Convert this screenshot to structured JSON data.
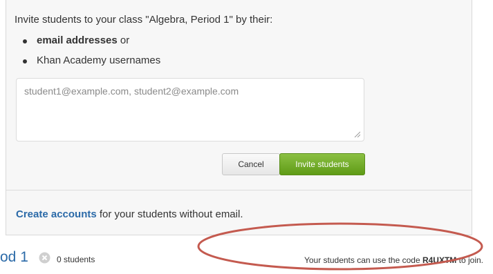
{
  "invite": {
    "prompt_prefix": "Invite students to your class \"",
    "class_name": "Algebra, Period 1",
    "prompt_suffix": "\" by their:",
    "options": [
      {
        "bold": "email addresses",
        "rest": " or"
      },
      {
        "bold": "",
        "rest": "Khan Academy usernames"
      }
    ],
    "textarea_placeholder": "student1@example.com, student2@example.com",
    "cancel_label": "Cancel",
    "invite_label": "Invite students"
  },
  "create": {
    "link_label": "Create accounts",
    "rest": " for your students without email."
  },
  "class_row": {
    "name_fragment": "od 1",
    "student_count": "0 students",
    "code_prefix": "Your students can use the code ",
    "code": "R4UXTM",
    "code_suffix": " to join."
  },
  "colors": {
    "link": "#2b6aa8",
    "invite_button": "#6aa51d",
    "annotation_ring": "#c45a4f"
  },
  "icons": {
    "remove": "remove-icon",
    "resize": "resize-grip-icon"
  }
}
